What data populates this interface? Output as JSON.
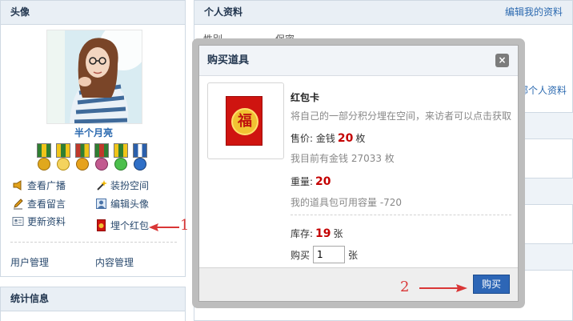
{
  "left": {
    "avatar_title": "头像",
    "username": "半个月亮",
    "actions": [
      {
        "label": "查看广播",
        "icon": "megaphone-icon"
      },
      {
        "label": "装扮空间",
        "icon": "wand-icon"
      },
      {
        "label": "查看留言",
        "icon": "pencil-icon"
      },
      {
        "label": "编辑头像",
        "icon": "edit-avatar-icon"
      },
      {
        "label": "更新资料",
        "icon": "id-card-icon"
      },
      {
        "label": "埋个红包",
        "icon": "red-envelope-icon"
      }
    ],
    "bottom_links": [
      "用户管理",
      "内容管理"
    ],
    "stats_title": "统计信息"
  },
  "right": {
    "profile_title": "个人资料",
    "edit_link": "编辑我的资料",
    "gender_label": "性别",
    "gender_value": "保密",
    "all_profile_link": "部个人资料"
  },
  "modal": {
    "title": "购买道具",
    "close_label": "×",
    "item_name": "红包卡",
    "item_desc": "将自己的一部分积分埋在空间，来访者可以点击获取",
    "price_label": "售价: 金钱",
    "price_value": "20",
    "price_unit": "枚",
    "balance_note": "我目前有金钱 27033 枚",
    "weight_label": "重量:",
    "weight_value": "20",
    "capacity_note": "我的道具包可用容量 -720",
    "stock_label": "库存:",
    "stock_value": "19",
    "stock_unit": "张",
    "buy_label": "购买",
    "buy_qty": "1",
    "buy_unit": "张",
    "buy_button": "购买",
    "item_glyph": "福"
  },
  "annotations": {
    "one": "1",
    "two": "2"
  },
  "colors": {
    "link": "#2c6ab0",
    "accent_red": "#c40000",
    "button_blue": "#2d66b6",
    "annotation_red": "#d93636"
  }
}
